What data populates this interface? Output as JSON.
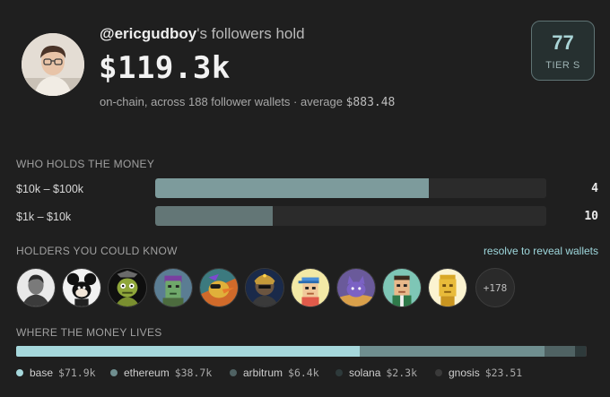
{
  "header": {
    "handle": "@ericgudboy",
    "suffix": "'s followers hold",
    "total": "$119.3k",
    "sub_prefix": "on-chain, across 188 follower wallets · average ",
    "average": "$883.48"
  },
  "tier": {
    "score": "77",
    "label": "TIER S"
  },
  "holdings": {
    "title": "WHO HOLDS THE MONEY",
    "rows": [
      {
        "label": "$10k – $100k",
        "count": "4",
        "fill_fraction": 0.7,
        "color": "#7d9b9c"
      },
      {
        "label": "$1k – $10k",
        "count": "10",
        "fill_fraction": 0.3,
        "color": "#637676"
      }
    ]
  },
  "holders": {
    "title": "HOLDERS YOU COULD KNOW",
    "link": "resolve to reveal wallets",
    "more": "+178",
    "avatars": [
      "person-avatar",
      "mickey-avatar",
      "frog-avatar",
      "punk-avatar",
      "bird-avatar",
      "warrior-avatar",
      "pixel-cap-avatar",
      "cat-avatar",
      "green-pixel-avatar",
      "gold-pixel-avatar"
    ]
  },
  "chains": {
    "title": "WHERE THE MONEY LIVES",
    "items": [
      {
        "name": "base",
        "value": "$71.9k",
        "share": 0.603,
        "color": "#a6d8dc"
      },
      {
        "name": "ethereum",
        "value": "$38.7k",
        "share": 0.324,
        "color": "#6f8e8f"
      },
      {
        "name": "arbitrum",
        "value": "$6.4k",
        "share": 0.054,
        "color": "#4f6263"
      },
      {
        "name": "solana",
        "value": "$2.3k",
        "share": 0.019,
        "color": "#2e3a3b"
      },
      {
        "name": "gnosis",
        "value": "$23.51",
        "share": 0.001,
        "color": "#3a3a3a"
      }
    ]
  }
}
